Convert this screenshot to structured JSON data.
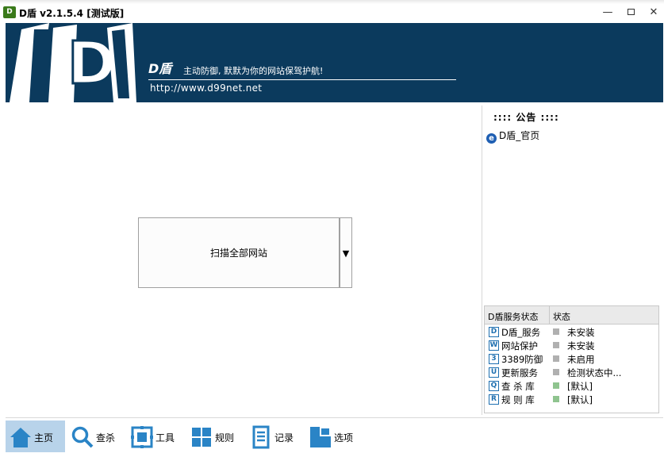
{
  "window": {
    "title": "D盾 v2.1.5.4 [测试版]",
    "icon_text": "D",
    "controls": [
      "minimize",
      "maximize",
      "close"
    ]
  },
  "banner": {
    "logo_text": "D",
    "name": "D盾",
    "slogan": "主动防御, 默默为你的网站保驾护航!",
    "url": "http://www.d99net.net"
  },
  "main": {
    "scan_button_label": "扫描全部网站",
    "scan_dropdown_glyph": "▼"
  },
  "notice": {
    "title": "::::  公告  ::::",
    "items": [
      {
        "icon": "ie-icon",
        "label": "D盾_官页"
      }
    ]
  },
  "status_panel": {
    "headers": [
      "D盾服务状态",
      "状态"
    ],
    "rows": [
      {
        "icon_text": "D",
        "name": "D盾_服务",
        "status": "未安装",
        "status_color": "#b0b0b0"
      },
      {
        "icon_text": "W",
        "name": "网站保护",
        "status": "未安装",
        "status_color": "#b0b0b0"
      },
      {
        "icon_text": "3",
        "name": "3389防御",
        "status": "未启用",
        "status_color": "#b0b0b0"
      },
      {
        "icon_text": "U",
        "name": "更新服务",
        "status": "检测状态中...",
        "status_color": "#b0b0b0"
      },
      {
        "icon_text": "Q",
        "name": "查 杀 库",
        "status": "[默认]",
        "status_color": "#8fc48f"
      },
      {
        "icon_text": "R",
        "name": "规 则 库",
        "status": "[默认]",
        "status_color": "#8fc48f"
      }
    ]
  },
  "toolbar": {
    "items": [
      {
        "icon": "home-icon",
        "label": "主页",
        "active": true
      },
      {
        "icon": "search-icon",
        "label": "查杀",
        "active": false
      },
      {
        "icon": "tools-icon",
        "label": "工具",
        "active": false
      },
      {
        "icon": "rules-icon",
        "label": "规则",
        "active": false
      },
      {
        "icon": "log-icon",
        "label": "记录",
        "active": false
      },
      {
        "icon": "options-icon",
        "label": "选项",
        "active": false
      }
    ]
  },
  "colors": {
    "banner_bg": "#0b3a5d",
    "accent_blue": "#1e6fb0",
    "active_tab": "#b8d3ea"
  }
}
